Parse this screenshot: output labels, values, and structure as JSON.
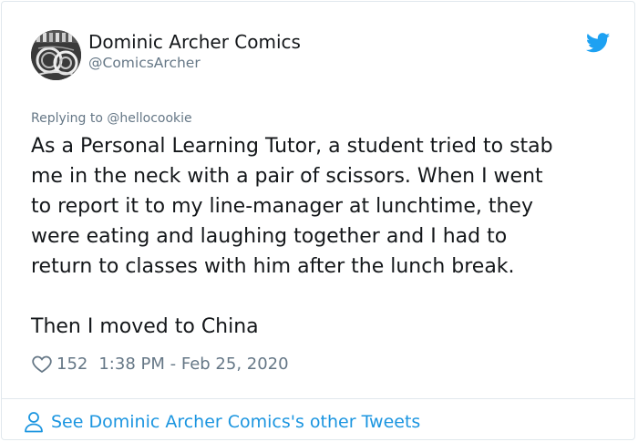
{
  "author": {
    "name": "Dominic Archer Comics",
    "handle": "@ComicsArcher"
  },
  "icons": {
    "avatar": "profile-photo",
    "brand": "twitter-bird-icon",
    "like": "heart-outline-icon",
    "profile": "person-outline-icon"
  },
  "colors": {
    "brand": "#1da1f2",
    "link": "#1b95e0",
    "secondary": "#657786",
    "text": "#14171a"
  },
  "reply": {
    "label": "Replying to @hellocookie"
  },
  "tweet": {
    "lines": [
      "As a Personal Learning Tutor, a student tried to stab",
      "me in the neck with a pair of scissors. When I went",
      "to report it to my line-manager at lunchtime, they",
      "were eating and laughing together and I had to",
      "return to classes with him after the lunch break."
    ],
    "closing": "Then I moved to China"
  },
  "meta": {
    "likes": "152",
    "timestamp": "1:38 PM - Feb 25, 2020"
  },
  "footer": {
    "link_label": "See Dominic Archer Comics's other Tweets"
  }
}
